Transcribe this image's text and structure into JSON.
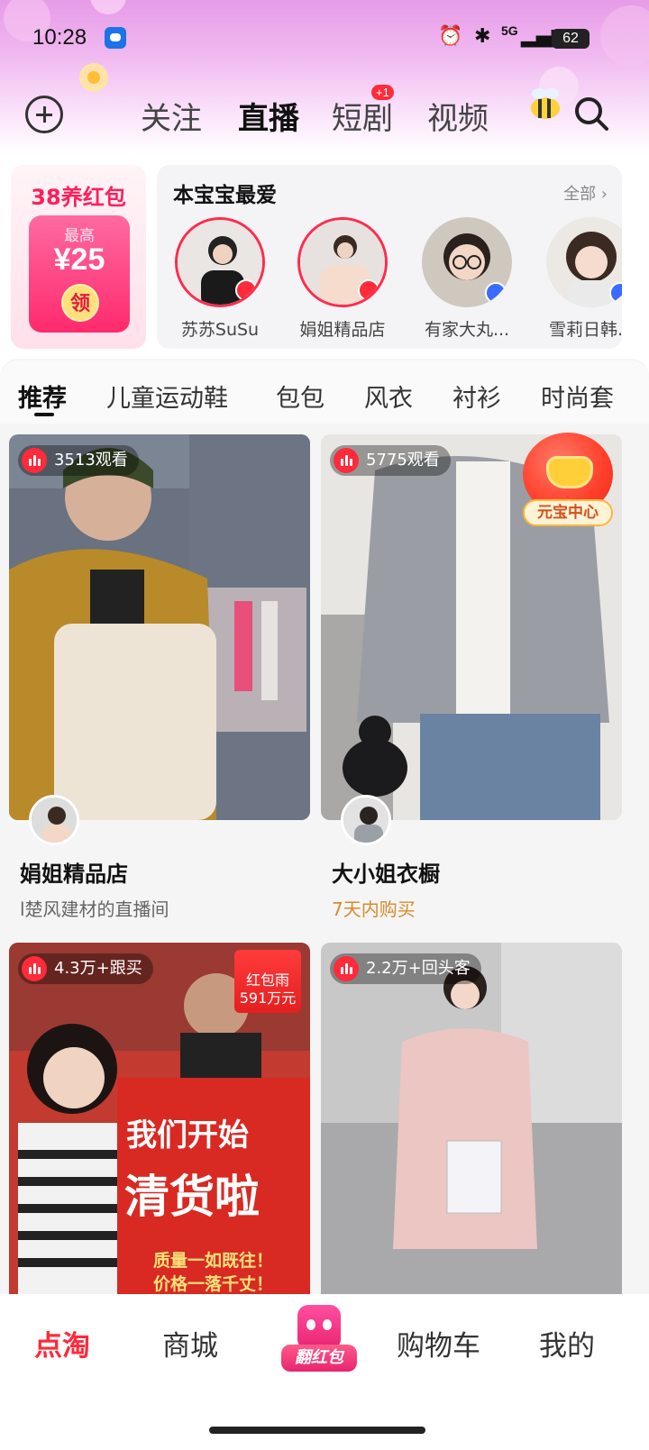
{
  "status_bar": {
    "time": "10:28",
    "network": "5G",
    "battery": "62"
  },
  "header": {
    "tabs": [
      {
        "label": "关注",
        "active": false
      },
      {
        "label": "直播",
        "active": true
      },
      {
        "label": "短剧",
        "active": false
      },
      {
        "label": "视频",
        "active": false
      }
    ],
    "drama_badge": "+1"
  },
  "promo": {
    "title": "38养红包",
    "max_label": "最高",
    "amount": "¥25",
    "claim": "领"
  },
  "favorites": {
    "title": "本宝宝最爱",
    "all_label": "全部 ›",
    "items": [
      {
        "name": "苏苏SuSu",
        "live": "red"
      },
      {
        "name": "娟姐精品店",
        "live": "red"
      },
      {
        "name": "有家大丸...",
        "live": "blue"
      },
      {
        "name": "雪莉日韩...",
        "live": "blue"
      }
    ]
  },
  "categories": [
    "推荐",
    "儿童运动鞋",
    "包包",
    "风衣",
    "衬衫",
    "时尚套"
  ],
  "feed": [
    {
      "chip": "3513观看",
      "title": "娟姐精品店",
      "subtitle": "l楚风建材的直播间",
      "sub_style": "gray"
    },
    {
      "chip": "5775观看",
      "title": "大小姐衣橱",
      "subtitle": "7天内购买",
      "sub_style": "orange"
    },
    {
      "chip": "4.3万+跟买",
      "rain_badge": "红包雨\n591万元",
      "sign": [
        "我们开始",
        "清货啦",
        "质量一如既往！",
        "价格一落千丈！"
      ]
    },
    {
      "chip": "2.2万+回头客"
    }
  ],
  "floating": {
    "label": "元宝中心"
  },
  "bottom_nav": {
    "items": [
      {
        "label": "点淘",
        "active": true
      },
      {
        "label": "商城",
        "active": false
      },
      {
        "label": "翻红包",
        "active": false
      },
      {
        "label": "购物车",
        "active": false
      },
      {
        "label": "我的",
        "active": false
      }
    ]
  },
  "colors": {
    "accent": "#ff2a3a",
    "brand_pink": "#ff2a6e",
    "gold": "#d88a2a"
  }
}
